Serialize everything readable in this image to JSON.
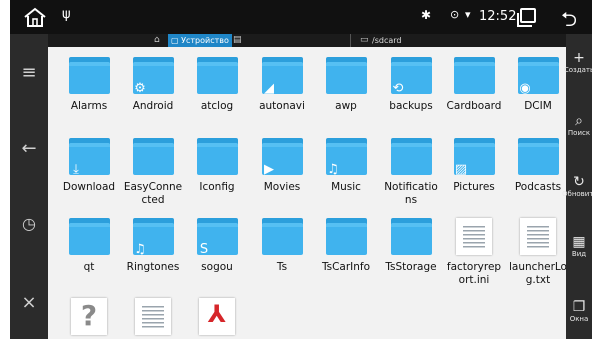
{
  "status_bar": {
    "home_icon": "home-icon",
    "usb_glyph": "ψ",
    "bluetooth_glyph": "✱",
    "location_glyph": "⊙",
    "wifi_glyph": "▾",
    "time": "12:52",
    "back_glyph": "⮌"
  },
  "breadcrumb": {
    "device_label": "Устройство",
    "sdcard_label": "/sdcard"
  },
  "left_sidebar": {
    "menu_glyph": "≡",
    "back_glyph": "←",
    "history_glyph": "◷",
    "close_glyph": "×"
  },
  "right_sidebar": [
    {
      "icon": "+",
      "label": "Создать"
    },
    {
      "icon": "⌕",
      "label": "Поиск"
    },
    {
      "icon": "↻",
      "label": "Обновить"
    },
    {
      "icon": "▦",
      "label": "Вид"
    },
    {
      "icon": "❐",
      "label": "Окна"
    }
  ],
  "files": [
    {
      "name": "Alarms",
      "type": "folder",
      "badge": ""
    },
    {
      "name": "Android",
      "type": "folder",
      "badge": "⚙"
    },
    {
      "name": "atclog",
      "type": "folder",
      "badge": ""
    },
    {
      "name": "autonavi",
      "type": "folder",
      "badge": "◢"
    },
    {
      "name": "awp",
      "type": "folder",
      "badge": ""
    },
    {
      "name": "backups",
      "type": "folder",
      "badge": "⟲"
    },
    {
      "name": "Cardboard",
      "type": "folder",
      "badge": ""
    },
    {
      "name": "DCIM",
      "type": "folder",
      "badge": "◉"
    },
    {
      "name": "Download",
      "type": "folder",
      "badge": "⤓"
    },
    {
      "name": "EasyConne\ncted",
      "type": "folder",
      "badge": ""
    },
    {
      "name": "Iconfig",
      "type": "folder",
      "badge": ""
    },
    {
      "name": "Movies",
      "type": "folder",
      "badge": "▶"
    },
    {
      "name": "Music",
      "type": "folder",
      "badge": "♫"
    },
    {
      "name": "Notificatio\nns",
      "type": "folder",
      "badge": ""
    },
    {
      "name": "Pictures",
      "type": "folder",
      "badge": "▨"
    },
    {
      "name": "Podcasts",
      "type": "folder",
      "badge": ""
    },
    {
      "name": "qt",
      "type": "folder",
      "badge": ""
    },
    {
      "name": "Ringtones",
      "type": "folder",
      "badge": "♫"
    },
    {
      "name": "sogou",
      "type": "folder",
      "badge": "S"
    },
    {
      "name": "Ts",
      "type": "folder",
      "badge": ""
    },
    {
      "name": "TsCarInfo",
      "type": "folder",
      "badge": ""
    },
    {
      "name": "TsStorage",
      "type": "folder",
      "badge": ""
    },
    {
      "name": "factoryrep\nort.ini",
      "type": "doc",
      "badge": ""
    },
    {
      "name": "launcherLo\ng.txt",
      "type": "doc",
      "badge": ""
    },
    {
      "name": "",
      "type": "unknown",
      "badge": "?"
    },
    {
      "name": "",
      "type": "doc",
      "badge": ""
    },
    {
      "name": "",
      "type": "pdf",
      "badge": "⅄"
    }
  ]
}
